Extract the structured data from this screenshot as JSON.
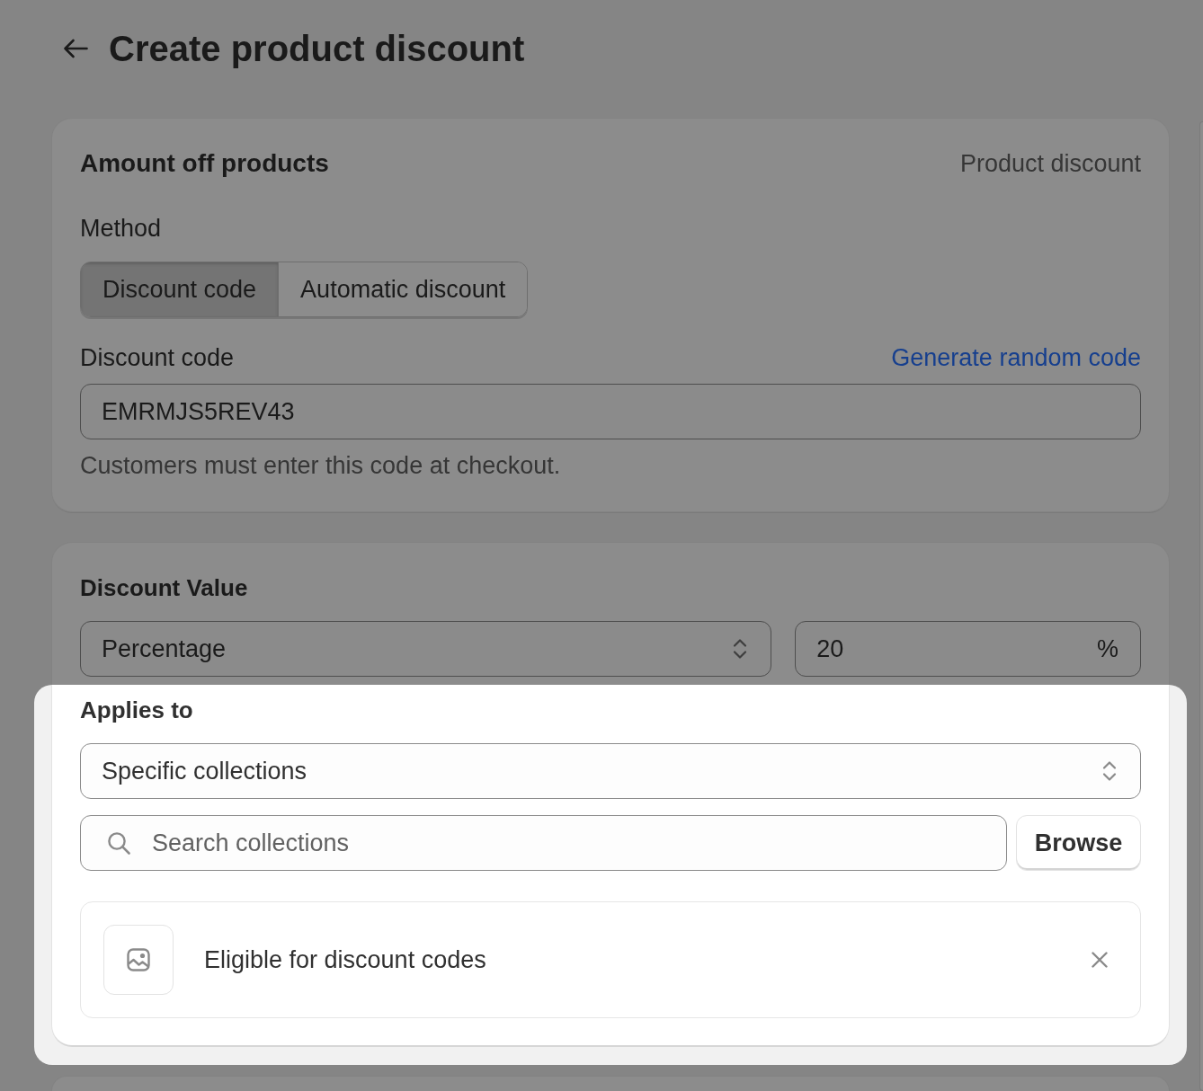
{
  "header": {
    "title": "Create product discount"
  },
  "method_card": {
    "title": "Amount off products",
    "type_label": "Product discount",
    "method_label": "Method",
    "methods": [
      {
        "label": "Discount code",
        "selected": true
      },
      {
        "label": "Automatic discount",
        "selected": false
      }
    ],
    "code_label": "Discount code",
    "generate_link": "Generate random code",
    "code_value": "EMRMJS5REV43",
    "help_text": "Customers must enter this code at checkout."
  },
  "value_card": {
    "title": "Discount Value",
    "value_type": "Percentage",
    "amount": "20",
    "amount_suffix": "%"
  },
  "applies_to": {
    "highlighted": true,
    "label": "Applies to",
    "scope": "Specific collections",
    "search": {
      "placeholder": "Search collections"
    },
    "browse_button": "Browse",
    "collections": [
      {
        "name": "Eligible for discount codes"
      }
    ]
  }
}
